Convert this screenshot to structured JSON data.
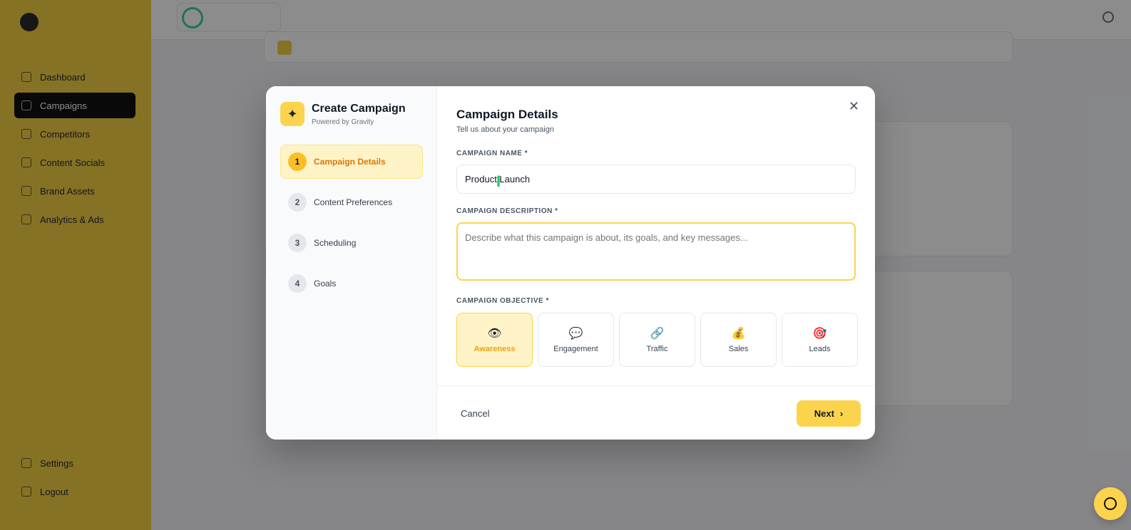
{
  "modal": {
    "title": "Create Campaign",
    "subtitle": "Powered by Gravity",
    "steps": [
      {
        "num": "1",
        "label": "Campaign Details"
      },
      {
        "num": "2",
        "label": "Content Preferences"
      },
      {
        "num": "3",
        "label": "Scheduling"
      },
      {
        "num": "4",
        "label": "Goals"
      }
    ],
    "section_title": "Campaign Details",
    "section_subtitle": "Tell us about your campaign",
    "name_label": "CAMPAIGN NAME *",
    "name_value": "Product Launch",
    "description_label": "CAMPAIGN DESCRIPTION *",
    "description_placeholder": "Describe what this campaign is about, its goals, and key messages...",
    "objective_label": "CAMPAIGN OBJECTIVE *",
    "objectives": [
      {
        "icon": "👁",
        "label": "Awareness"
      },
      {
        "icon": "💬",
        "label": "Engagement"
      },
      {
        "icon": "🔗",
        "label": "Traffic"
      },
      {
        "icon": "💰",
        "label": "Sales"
      },
      {
        "icon": "🎯",
        "label": "Leads"
      }
    ],
    "cancel_label": "Cancel",
    "next_label": "Next",
    "close_glyph": "✕"
  },
  "background": {
    "nav_items": [
      "Dashboard",
      "Campaigns",
      "Competitors",
      "Content Socials",
      "Brand Assets",
      "Analytics & Ads"
    ],
    "nav_bottom": [
      "Settings",
      "Logout"
    ]
  },
  "colors": {
    "accent": "#fcd34d",
    "sidebar": "#f2cf43"
  }
}
